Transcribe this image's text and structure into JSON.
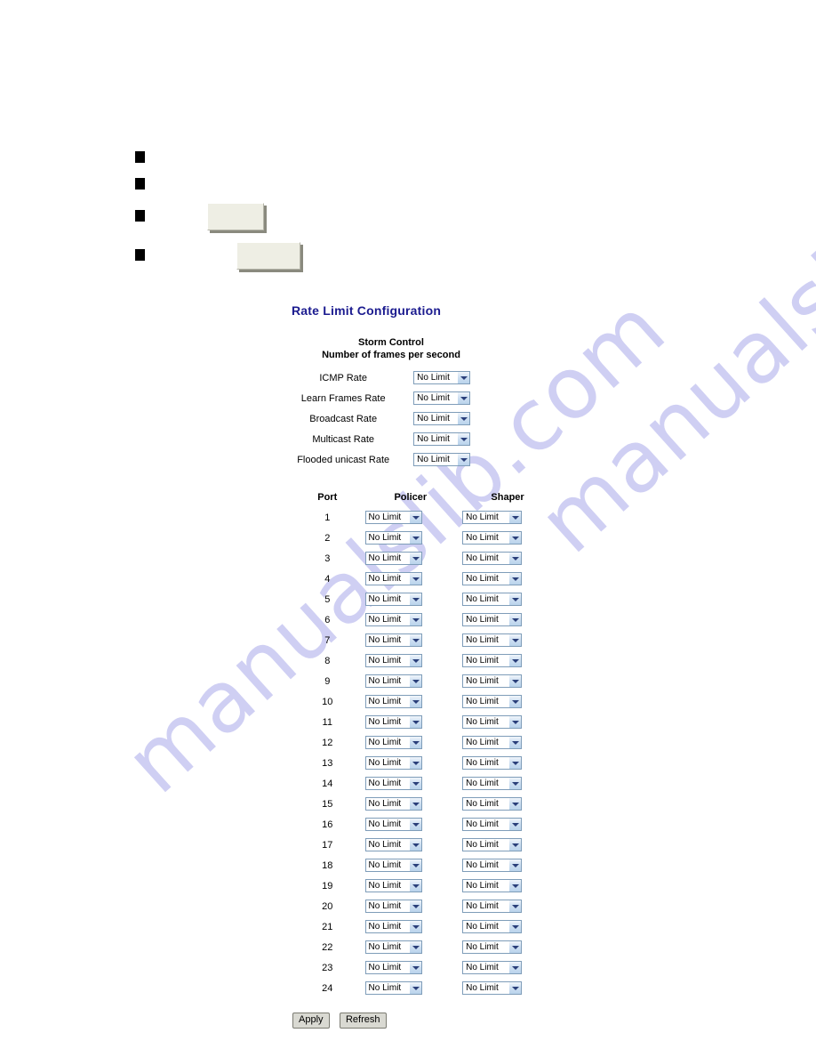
{
  "document": {
    "bullets": [
      {
        "marker": "■",
        "text": ""
      },
      {
        "marker": "■",
        "text": ""
      },
      {
        "marker": "■",
        "text": ""
      },
      {
        "marker": "■",
        "text": ""
      }
    ],
    "watermark": "manualslib.com",
    "watermark_color": "#ccccf2"
  },
  "ui": {
    "page_title": "Rate Limit Configuration",
    "title_color": "#1b1b8f",
    "storm_control": {
      "header_line1": "Storm Control",
      "header_line2": "Number of frames per second",
      "rows": [
        {
          "label": "ICMP Rate",
          "value": "No Limit"
        },
        {
          "label": "Learn Frames Rate",
          "value": "No Limit"
        },
        {
          "label": "Broadcast Rate",
          "value": "No Limit"
        },
        {
          "label": "Multicast Rate",
          "value": "No Limit"
        },
        {
          "label": "Flooded unicast Rate",
          "value": "No Limit"
        }
      ]
    },
    "port_table": {
      "columns": [
        "Port",
        "Policer",
        "Shaper"
      ],
      "rows": [
        {
          "port": "1",
          "policer": "No Limit",
          "shaper": "No Limit"
        },
        {
          "port": "2",
          "policer": "No Limit",
          "shaper": "No Limit"
        },
        {
          "port": "3",
          "policer": "No Limit",
          "shaper": "No Limit"
        },
        {
          "port": "4",
          "policer": "No Limit",
          "shaper": "No Limit"
        },
        {
          "port": "5",
          "policer": "No Limit",
          "shaper": "No Limit"
        },
        {
          "port": "6",
          "policer": "No Limit",
          "shaper": "No Limit"
        },
        {
          "port": "7",
          "policer": "No Limit",
          "shaper": "No Limit"
        },
        {
          "port": "8",
          "policer": "No Limit",
          "shaper": "No Limit"
        },
        {
          "port": "9",
          "policer": "No Limit",
          "shaper": "No Limit"
        },
        {
          "port": "10",
          "policer": "No Limit",
          "shaper": "No Limit"
        },
        {
          "port": "11",
          "policer": "No Limit",
          "shaper": "No Limit"
        },
        {
          "port": "12",
          "policer": "No Limit",
          "shaper": "No Limit"
        },
        {
          "port": "13",
          "policer": "No Limit",
          "shaper": "No Limit"
        },
        {
          "port": "14",
          "policer": "No Limit",
          "shaper": "No Limit"
        },
        {
          "port": "15",
          "policer": "No Limit",
          "shaper": "No Limit"
        },
        {
          "port": "16",
          "policer": "No Limit",
          "shaper": "No Limit"
        },
        {
          "port": "17",
          "policer": "No Limit",
          "shaper": "No Limit"
        },
        {
          "port": "18",
          "policer": "No Limit",
          "shaper": "No Limit"
        },
        {
          "port": "19",
          "policer": "No Limit",
          "shaper": "No Limit"
        },
        {
          "port": "20",
          "policer": "No Limit",
          "shaper": "No Limit"
        },
        {
          "port": "21",
          "policer": "No Limit",
          "shaper": "No Limit"
        },
        {
          "port": "22",
          "policer": "No Limit",
          "shaper": "No Limit"
        },
        {
          "port": "23",
          "policer": "No Limit",
          "shaper": "No Limit"
        },
        {
          "port": "24",
          "policer": "No Limit",
          "shaper": "No Limit"
        }
      ]
    },
    "actions": {
      "apply_label": "Apply",
      "refresh_label": "Refresh"
    }
  }
}
